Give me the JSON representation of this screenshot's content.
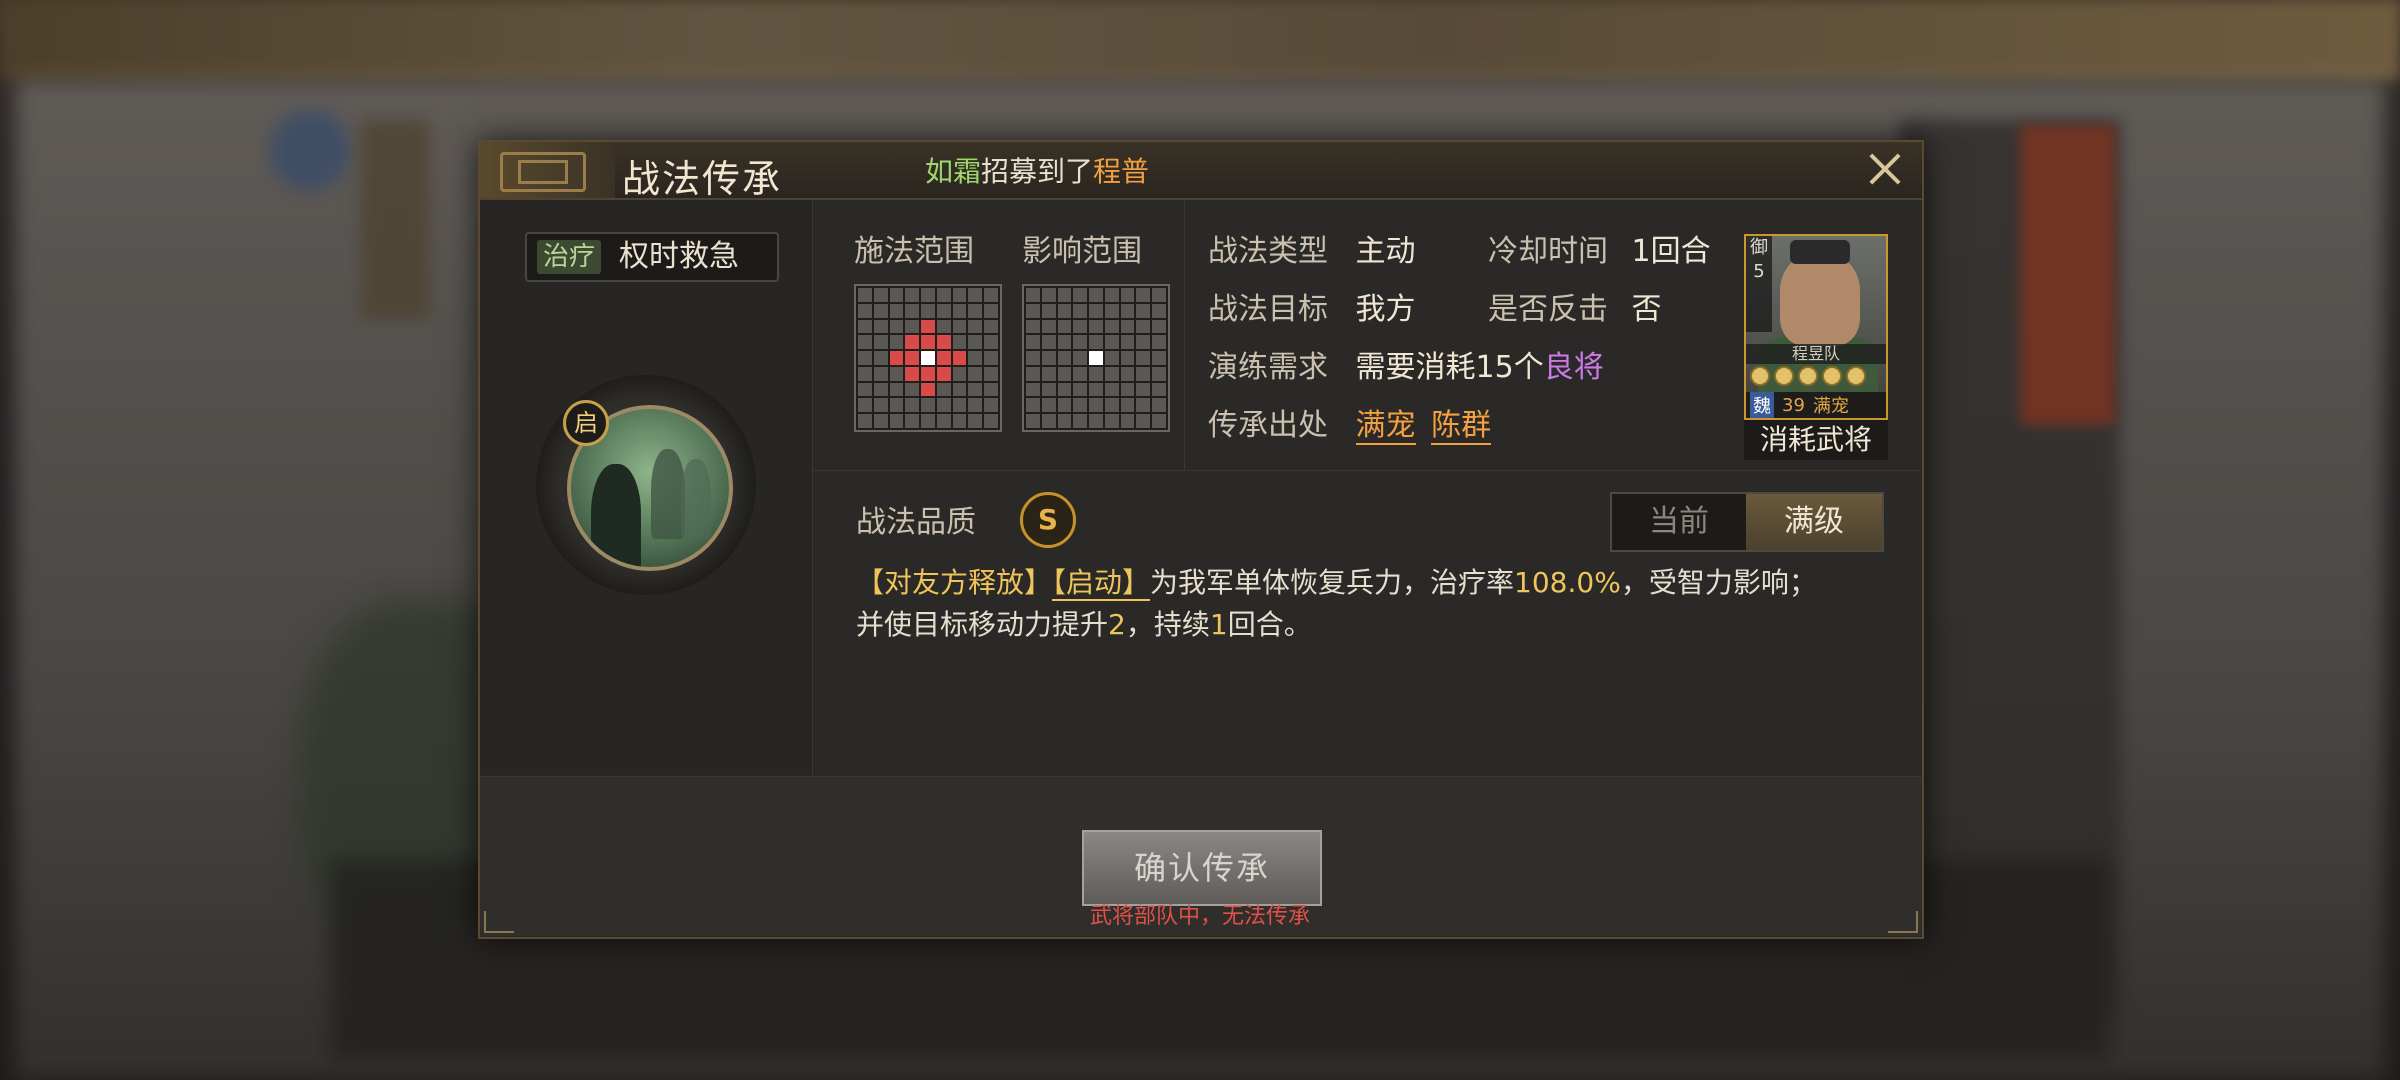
{
  "dialog": {
    "title": "战法传承",
    "notice": {
      "prefix": "如霜",
      "middle": "招募到了",
      "general": "程普"
    }
  },
  "skill": {
    "tag": "治疗",
    "name": "权时救急",
    "badge": "启"
  },
  "range": {
    "cast_label": "施法范围",
    "effect_label": "影响范围"
  },
  "info": {
    "type_label": "战法类型",
    "type_value": "主动",
    "cooldown_label": "冷却时间",
    "cooldown_value": "1回合",
    "target_label": "战法目标",
    "target_value": "我方",
    "counter_label": "是否反击",
    "counter_value": "否",
    "practice_label": "演练需求",
    "practice_prefix": "需要消耗",
    "practice_count": "15个",
    "practice_item": "良将",
    "source_label": "传承出处",
    "source_1": "满宠",
    "source_2": "陈群"
  },
  "card": {
    "side_1": "御",
    "side_2": "5",
    "team": "程昱队",
    "faction": "魏",
    "level": "39",
    "general": "满宠",
    "caption": "消耗武将"
  },
  "quality": {
    "label": "战法品质",
    "grade": "S"
  },
  "toggle": {
    "current": "当前",
    "max": "满级"
  },
  "description": {
    "tag1": "【对友方释放】",
    "tag2": "【启动】",
    "text1": "为我军单体恢复兵力，治疗率",
    "rate": "108.0%",
    "text2": "，受智力影响；",
    "text3": "并使目标移动力提升",
    "boost": "2",
    "text4": "，持续",
    "turns": "1",
    "text5": "回合。"
  },
  "footer": {
    "confirm": "确认传承",
    "warning": "武将部队中，无法传承"
  },
  "colors": {
    "accent": "#efc45a",
    "warning": "#e0504a",
    "rare": "#c97ae6",
    "general": "#f2a040"
  }
}
